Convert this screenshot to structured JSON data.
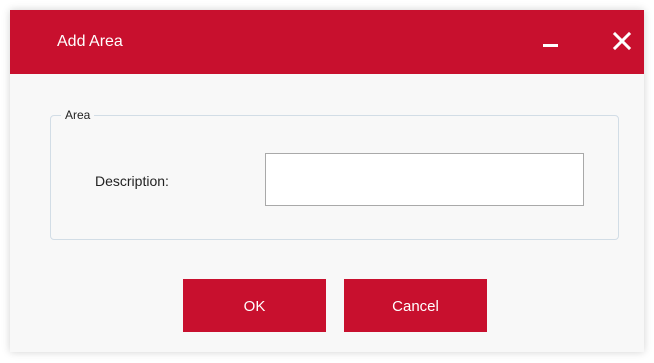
{
  "window": {
    "title": "Add Area",
    "minimize_icon": "minimize-icon",
    "close_icon": "close-icon"
  },
  "colors": {
    "accent": "#c8102e",
    "background": "#f8f8f8",
    "group_border": "#d2dde6"
  },
  "group": {
    "legend": "Area",
    "description_label": "Description:",
    "description_value": "",
    "description_placeholder": ""
  },
  "buttons": {
    "ok_label": "OK",
    "cancel_label": "Cancel"
  }
}
